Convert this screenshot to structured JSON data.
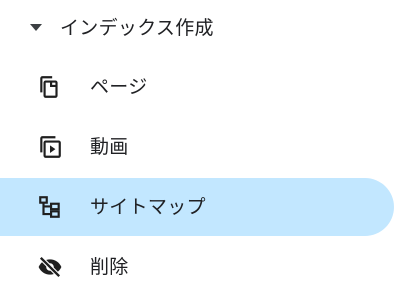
{
  "nav": {
    "section": {
      "title": "インデックス作成",
      "expanded": true,
      "icon": "caret-down-icon"
    },
    "items": [
      {
        "label": "ページ",
        "icon": "pages-copy-icon",
        "active": false
      },
      {
        "label": "動画",
        "icon": "video-pages-icon",
        "active": false
      },
      {
        "label": "サイトマップ",
        "icon": "sitemap-icon",
        "active": true
      },
      {
        "label": "削除",
        "icon": "visibility-off-icon",
        "active": false
      }
    ]
  },
  "colors": {
    "active_background": "#c2e7ff",
    "text": "#202124",
    "icon": "#1f1f1f"
  }
}
